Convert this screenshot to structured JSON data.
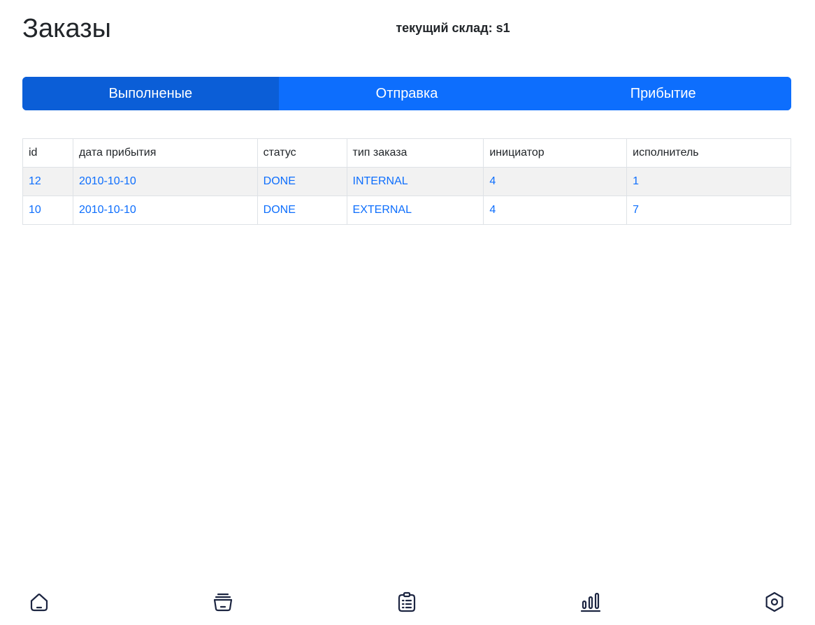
{
  "header": {
    "title": "Заказы",
    "warehouse": "текущий склад: s1"
  },
  "tabs": [
    {
      "label": "Выполненые",
      "active": true
    },
    {
      "label": "Отправка",
      "active": false
    },
    {
      "label": "Прибытие",
      "active": false
    }
  ],
  "table": {
    "columns": [
      "id",
      "дата прибытия",
      "статус",
      "тип заказа",
      "инициатор",
      "исполнитель"
    ],
    "rows": [
      [
        "12",
        "2010-10-10",
        "DONE",
        "INTERNAL",
        "4",
        "1"
      ],
      [
        "10",
        "2010-10-10",
        "DONE",
        "EXTERNAL",
        "4",
        "7"
      ]
    ]
  },
  "bottom_nav": {
    "items": [
      {
        "icon": "home-icon"
      },
      {
        "icon": "inventory-icon"
      },
      {
        "icon": "clipboard-list-icon"
      },
      {
        "icon": "bar-chart-icon"
      },
      {
        "icon": "settings-icon"
      }
    ]
  },
  "colors": {
    "primary": "#0d6efd",
    "primary_active": "#0b5ed7",
    "text": "#212529",
    "icon": "#1c2541",
    "row_stripe": "#f2f2f2"
  }
}
